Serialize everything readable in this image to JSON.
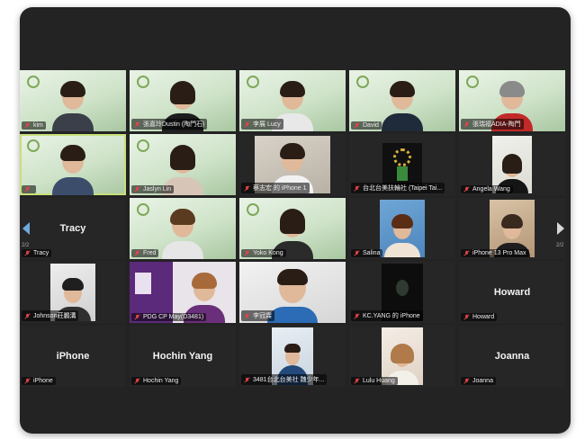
{
  "participants": [
    {
      "id": "kim",
      "name": "kim",
      "type": "video",
      "row": 0,
      "col": 0
    },
    {
      "id": "p2",
      "name": "張嘉玲Dustin (陶門石)",
      "type": "video",
      "row": 0,
      "col": 1
    },
    {
      "id": "lucy",
      "name": "李展 Lucy",
      "type": "video",
      "row": 0,
      "col": 2
    },
    {
      "id": "david",
      "name": "David",
      "type": "video",
      "row": 0,
      "col": 3
    },
    {
      "id": "p5",
      "name": "張瑞福ADIA-陶門",
      "type": "video",
      "row": 0,
      "col": 4
    },
    {
      "id": "p6",
      "name": "",
      "type": "video",
      "row": 1,
      "col": 0,
      "speaking": true
    },
    {
      "id": "jasyln",
      "name": "Jaslyn Lin",
      "type": "video",
      "row": 1,
      "col": 1
    },
    {
      "id": "p8",
      "name": "蔡志宏 的 iPhone 1",
      "type": "video",
      "row": 1,
      "col": 2
    },
    {
      "id": "taipei",
      "name": "台北台美扶輪社 (Taipei Tai...",
      "type": "logo",
      "row": 1,
      "col": 3
    },
    {
      "id": "angela",
      "name": "Angela Wang",
      "type": "video",
      "row": 1,
      "col": 4
    },
    {
      "id": "tracy",
      "name": "Tracy",
      "display": "Tracy",
      "type": "name",
      "row": 2,
      "col": 0
    },
    {
      "id": "p12",
      "name": "Fred",
      "type": "video",
      "row": 2,
      "col": 1
    },
    {
      "id": "yoko",
      "name": "Yoko Kong",
      "type": "video",
      "row": 2,
      "col": 2
    },
    {
      "id": "salina",
      "name": "Salina",
      "type": "video",
      "row": 2,
      "col": 3
    },
    {
      "id": "iphonemax",
      "name": "iPhone 13 Pro Max",
      "type": "video",
      "row": 2,
      "col": 4
    },
    {
      "id": "johnson",
      "name": "Johnson莊鵬溝",
      "type": "video",
      "row": 3,
      "col": 0
    },
    {
      "id": "pdg",
      "name": "PDG CP May(D3481)",
      "type": "video",
      "row": 3,
      "col": 1
    },
    {
      "id": "p18",
      "name": "李冠霖",
      "type": "video",
      "row": 3,
      "col": 2
    },
    {
      "id": "kcyang",
      "name": "KC.YANG 的 iPhone",
      "type": "dark",
      "row": 3,
      "col": 3
    },
    {
      "id": "howard",
      "name": "Howard",
      "display": "Howard",
      "type": "name",
      "row": 3,
      "col": 4
    },
    {
      "id": "iphone",
      "name": "iPhone",
      "display": "iPhone",
      "type": "name",
      "row": 4,
      "col": 0
    },
    {
      "id": "hochin",
      "name": "Hochin Yang",
      "display": "Hochin Yang",
      "type": "name",
      "row": 4,
      "col": 1
    },
    {
      "id": "p23",
      "name": "3481台北台美社 魏少年...",
      "type": "video",
      "row": 4,
      "col": 2
    },
    {
      "id": "lulu",
      "name": "Lulu Huang",
      "type": "video",
      "row": 4,
      "col": 3
    },
    {
      "id": "joanna",
      "name": "Joanna",
      "display": "Joanna",
      "type": "name",
      "row": 4,
      "col": 4
    }
  ],
  "navigation": {
    "prev_page": "2/2",
    "next_page": "2/2",
    "prev_icon": "chevron-left-icon",
    "next_icon": "chevron-right-icon"
  },
  "colors": {
    "tile_bg": "#262626",
    "frame_bg": "#232323",
    "mic_muted": "#e04545",
    "speaking_border": "#c7e07a"
  }
}
